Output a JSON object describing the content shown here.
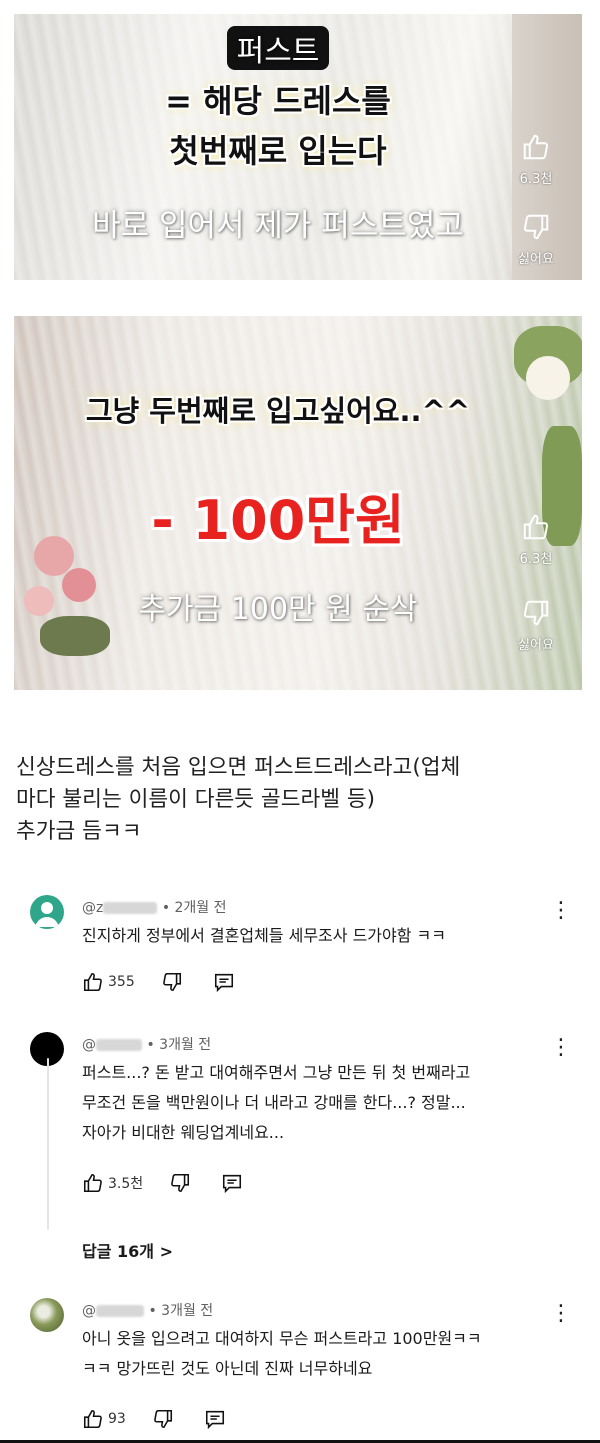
{
  "video_frames": [
    {
      "captions": [
        "퍼스트",
        "= 해당 드레스를",
        "첫번째로 입는다",
        "바로 입어서 제가 퍼스트였고"
      ],
      "like_count": "6.3천",
      "dislike_label": "싫어요"
    },
    {
      "captions": [
        "그냥 두번째로 입고싶어요..^^",
        "- 100만원",
        "추가금 100만 원 순삭"
      ],
      "like_count": "6.3천",
      "dislike_label": "싫어요"
    }
  ],
  "description": {
    "lines": [
      "신상드레스를 처음 입으면  퍼스트드레스라고(업체",
      "마다 불리는 이름이 다른듯 골드라벨 등)",
      "추가금 듬ㅋㅋ"
    ]
  },
  "comments": [
    {
      "handle": "@z",
      "time": "• 2개월 전",
      "text_lines": [
        "진지하게 정부에서 결혼업체들 세무조사 드가야함 ㅋㅋ"
      ],
      "likes": "355",
      "avatar_color": "#2fa58a"
    },
    {
      "handle": "@",
      "time": "• 3개월 전",
      "text_lines": [
        "퍼스트...? 돈 받고 대여해주면서 그냥 만든 뒤 첫 번째라고",
        "무조건 돈을 백만원이나 더 내라고 강매를 한다...? 정말...",
        "자아가 비대한 웨딩업계네요..."
      ],
      "likes": "3.5천",
      "replies": "답글 16개 >",
      "avatar_color": "#000000"
    },
    {
      "handle": "@",
      "time": "• 3개월 전",
      "text_lines": [
        "아니 옷을 입으려고 대여하지 무슨 퍼스트라고 100만원ㅋㅋ",
        "ㅋㅋ 망가뜨린 것도 아닌데 진짜 너무하네요"
      ],
      "likes": "93",
      "avatar_color": "#6f7d4a"
    }
  ],
  "colors": {
    "caption_red": "#e8231f",
    "meta_gray": "#606060"
  },
  "icons": [
    "thumb-up-icon",
    "thumb-down-icon",
    "comment-reply-icon",
    "more-vert-icon"
  ]
}
